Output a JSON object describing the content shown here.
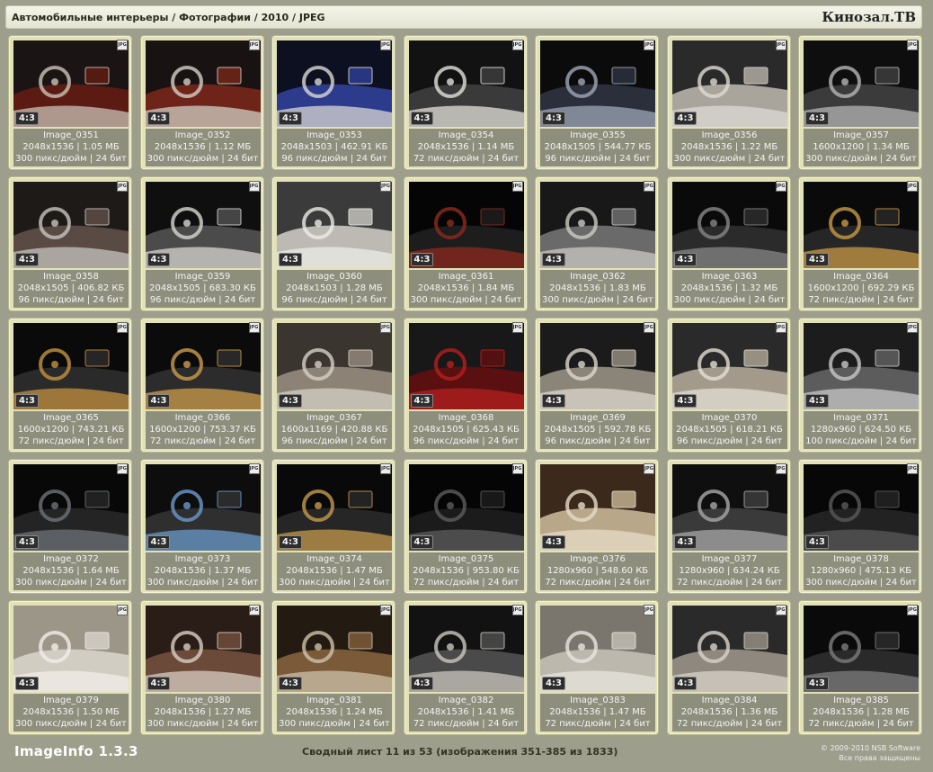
{
  "header": {
    "breadcrumb": "Автомобильные интерьеры / Фотографии / 2010 / JPEG",
    "brand": "Кинозал.ТВ"
  },
  "file_badge": "JPG",
  "images": [
    {
      "name": "Image_0351",
      "dims": "2048x1536",
      "size": "1.05 МБ",
      "dpi": "300 пикс/дюйм",
      "bits": "24 бит",
      "aspect": "4:3",
      "palette": [
        "#1b1414",
        "#5c1b12",
        "#c9c3b8"
      ]
    },
    {
      "name": "Image_0352",
      "dims": "2048x1536",
      "size": "1.12 МБ",
      "dpi": "300 пикс/дюйм",
      "bits": "24 бит",
      "aspect": "4:3",
      "palette": [
        "#191212",
        "#6e2418",
        "#d3cfc5"
      ]
    },
    {
      "name": "Image_0353",
      "dims": "2048x1503",
      "size": "462.91 КБ",
      "dpi": "96 пикс/дюйм",
      "bits": "24 бит",
      "aspect": "4:3",
      "palette": [
        "#0d1020",
        "#2c3b8c",
        "#d9d8d4"
      ]
    },
    {
      "name": "Image_0354",
      "dims": "2048x1536",
      "size": "1.14 МБ",
      "dpi": "72 пикс/дюйм",
      "bits": "24 бит",
      "aspect": "4:3",
      "palette": [
        "#121212",
        "#3a3a3a",
        "#e3e1db"
      ]
    },
    {
      "name": "Image_0355",
      "dims": "2048x1505",
      "size": "544.77 КБ",
      "dpi": "96 пикс/дюйм",
      "bits": "24 бит",
      "aspect": "4:3",
      "palette": [
        "#0b0b0b",
        "#2a2f3b",
        "#9da7b7"
      ]
    },
    {
      "name": "Image_0356",
      "dims": "2048x1536",
      "size": "1.22 МБ",
      "dpi": "300 пикс/дюйм",
      "bits": "24 бит",
      "aspect": "4:3",
      "palette": [
        "#2a2a2a",
        "#a9a59c",
        "#dedbd4"
      ]
    },
    {
      "name": "Image_0357",
      "dims": "1600x1200",
      "size": "1.34 МБ",
      "dpi": "300 пикс/дюйм",
      "bits": "24 бит",
      "aspect": "4:3",
      "palette": [
        "#0e0e0e",
        "#3b3b3b",
        "#b5b5b5"
      ]
    },
    {
      "name": "Image_0358",
      "dims": "2048x1505",
      "size": "406.82 КБ",
      "dpi": "96 пикс/дюйм",
      "bits": "24 бит",
      "aspect": "4:3",
      "palette": [
        "#1e1a18",
        "#5a4a44",
        "#c7c4bf"
      ]
    },
    {
      "name": "Image_0359",
      "dims": "2048x1505",
      "size": "683.30 КБ",
      "dpi": "96 пикс/дюйм",
      "bits": "24 бит",
      "aspect": "4:3",
      "palette": [
        "#0f0f0f",
        "#4b4b4b",
        "#d7d6d2"
      ]
    },
    {
      "name": "Image_0360",
      "dims": "2048x1503",
      "size": "1.28 МБ",
      "dpi": "96 пикс/дюйм",
      "bits": "24 бит",
      "aspect": "4:3",
      "palette": [
        "#3b3b3b",
        "#bcbab3",
        "#ecebe6"
      ]
    },
    {
      "name": "Image_0361",
      "dims": "2048x1536",
      "size": "1.84 МБ",
      "dpi": "300 пикс/дюйм",
      "bits": "24 бит",
      "aspect": "4:3",
      "palette": [
        "#050505",
        "#1d1d1d",
        "#8c2a1e"
      ]
    },
    {
      "name": "Image_0362",
      "dims": "2048x1536",
      "size": "1.83 МБ",
      "dpi": "300 пикс/дюйм",
      "bits": "24 бит",
      "aspect": "4:3",
      "palette": [
        "#181818",
        "#6a6a6a",
        "#cbcac5"
      ]
    },
    {
      "name": "Image_0363",
      "dims": "2048x1536",
      "size": "1.32 МБ",
      "dpi": "300 пикс/дюйм",
      "bits": "24 бит",
      "aspect": "4:3",
      "palette": [
        "#0a0a0a",
        "#2b2b2b",
        "#878787"
      ]
    },
    {
      "name": "Image_0364",
      "dims": "1600x1200",
      "size": "692.29 КБ",
      "dpi": "72 пикс/дюйм",
      "bits": "24 бит",
      "aspect": "4:3",
      "palette": [
        "#0a0a0a",
        "#262626",
        "#c89a45"
      ]
    },
    {
      "name": "Image_0365",
      "dims": "1600x1200",
      "size": "743.21 КБ",
      "dpi": "72 пикс/дюйм",
      "bits": "24 бит",
      "aspect": "4:3",
      "palette": [
        "#0a0a0a",
        "#2a2a2a",
        "#c3923f"
      ]
    },
    {
      "name": "Image_0366",
      "dims": "1600x1200",
      "size": "753.37 КБ",
      "dpi": "72 пикс/дюйм",
      "bits": "24 бит",
      "aspect": "4:3",
      "palette": [
        "#0b0b0b",
        "#2c2c2c",
        "#cc9c4b"
      ]
    },
    {
      "name": "Image_0367",
      "dims": "1600x1169",
      "size": "420.88 КБ",
      "dpi": "96 пикс/дюйм",
      "bits": "24 бит",
      "aspect": "4:3",
      "palette": [
        "#3b3530",
        "#8d8276",
        "#d6d0c6"
      ]
    },
    {
      "name": "Image_0368",
      "dims": "2048x1505",
      "size": "625.43 КБ",
      "dpi": "96 пикс/дюйм",
      "bits": "24 бит",
      "aspect": "4:3",
      "palette": [
        "#181818",
        "#5a1010",
        "#b51f1f"
      ]
    },
    {
      "name": "Image_0369",
      "dims": "2048x1505",
      "size": "592.78 КБ",
      "dpi": "96 пикс/дюйм",
      "bits": "24 бит",
      "aspect": "4:3",
      "palette": [
        "#1b1b1b",
        "#8b8478",
        "#dcd7cd"
      ]
    },
    {
      "name": "Image_0370",
      "dims": "2048x1505",
      "size": "618.21 КБ",
      "dpi": "96 пикс/дюйм",
      "bits": "24 бит",
      "aspect": "4:3",
      "palette": [
        "#2a2a2a",
        "#a39a8c",
        "#e3ded4"
      ]
    },
    {
      "name": "Image_0371",
      "dims": "1280x960",
      "size": "624.50 КБ",
      "dpi": "100 пикс/дюйм",
      "bits": "24 бит",
      "aspect": "4:3",
      "palette": [
        "#1c1c1c",
        "#5c5c5c",
        "#c8c8c8"
      ]
    },
    {
      "name": "Image_0372",
      "dims": "2048x1536",
      "size": "1.64 МБ",
      "dpi": "300 пикс/дюйм",
      "bits": "24 бит",
      "aspect": "4:3",
      "palette": [
        "#080808",
        "#242424",
        "#6e7277"
      ]
    },
    {
      "name": "Image_0373",
      "dims": "2048x1536",
      "size": "1.37 МБ",
      "dpi": "300 пикс/дюйм",
      "bits": "24 бит",
      "aspect": "4:3",
      "palette": [
        "#0d0d0d",
        "#2f2f2f",
        "#6b9acb"
      ]
    },
    {
      "name": "Image_0374",
      "dims": "2048x1536",
      "size": "1.47 МБ",
      "dpi": "300 пикс/дюйм",
      "bits": "24 бит",
      "aspect": "4:3",
      "palette": [
        "#090909",
        "#262626",
        "#c49a4c"
      ]
    },
    {
      "name": "Image_0375",
      "dims": "2048x1536",
      "size": "953.80 КБ",
      "dpi": "72 пикс/дюйм",
      "bits": "24 бит",
      "aspect": "4:3",
      "palette": [
        "#050505",
        "#1b1b1b",
        "#5d5d5d"
      ]
    },
    {
      "name": "Image_0376",
      "dims": "1280x960",
      "size": "548.60 КБ",
      "dpi": "72 пикс/дюйм",
      "bits": "24 бит",
      "aspect": "4:3",
      "palette": [
        "#3b2a1c",
        "#b9a78a",
        "#e7dcc7"
      ]
    },
    {
      "name": "Image_0377",
      "dims": "1280x960",
      "size": "634.24 КБ",
      "dpi": "72 пикс/дюйм",
      "bits": "24 бит",
      "aspect": "4:3",
      "palette": [
        "#0f0f0f",
        "#3a3a3a",
        "#a8a8a8"
      ]
    },
    {
      "name": "Image_0378",
      "dims": "1280x960",
      "size": "475.13 КБ",
      "dpi": "300 пикс/дюйм",
      "bits": "24 бит",
      "aspect": "4:3",
      "palette": [
        "#070707",
        "#222222",
        "#5a5a5a"
      ]
    },
    {
      "name": "Image_0379",
      "dims": "2048x1536",
      "size": "1.50 МБ",
      "dpi": "300 пикс/дюйм",
      "bits": "24 бит",
      "aspect": "4:3",
      "palette": [
        "#9c9689",
        "#d2cdc2",
        "#f1eee8"
      ]
    },
    {
      "name": "Image_0380",
      "dims": "2048x1536",
      "size": "1.27 МБ",
      "dpi": "300 пикс/дюйм",
      "bits": "24 бит",
      "aspect": "4:3",
      "palette": [
        "#2a1c16",
        "#6b4a3a",
        "#d8cfc4"
      ]
    },
    {
      "name": "Image_0381",
      "dims": "2048x1536",
      "size": "1.24 МБ",
      "dpi": "300 пикс/дюйм",
      "bits": "24 бит",
      "aspect": "4:3",
      "palette": [
        "#231a12",
        "#7a5a38",
        "#cfc2aa"
      ]
    },
    {
      "name": "Image_0382",
      "dims": "2048x1536",
      "size": "1.41 МБ",
      "dpi": "72 пикс/дюйм",
      "bits": "24 бит",
      "aspect": "4:3",
      "palette": [
        "#121212",
        "#4a4a4a",
        "#cbc7bf"
      ]
    },
    {
      "name": "Image_0383",
      "dims": "2048x1536",
      "size": "1.47 МБ",
      "dpi": "72 пикс/дюйм",
      "bits": "24 бит",
      "aspect": "4:3",
      "palette": [
        "#7a766e",
        "#bdb8ae",
        "#e8e5de"
      ]
    },
    {
      "name": "Image_0384",
      "dims": "2048x1536",
      "size": "1.36 МБ",
      "dpi": "72 пикс/дюйм",
      "bits": "24 бит",
      "aspect": "4:3",
      "palette": [
        "#2a2a2a",
        "#8e887e",
        "#d9d3c9"
      ]
    },
    {
      "name": "Image_0385",
      "dims": "2048x1536",
      "size": "1.28 МБ",
      "dpi": "72 пикс/дюйм",
      "bits": "24 бит",
      "aspect": "4:3",
      "palette": [
        "#0a0a0a",
        "#2a2a2a",
        "#7d7d7d"
      ]
    }
  ],
  "footer": {
    "app_name": "ImageInfo 1.3.3",
    "summary": "Сводный лист 11 из 53 (изображения 351-385 из 1833)",
    "copyright_line1": "© 2009-2010 NSB Software",
    "copyright_line2": "Все права защищены"
  }
}
